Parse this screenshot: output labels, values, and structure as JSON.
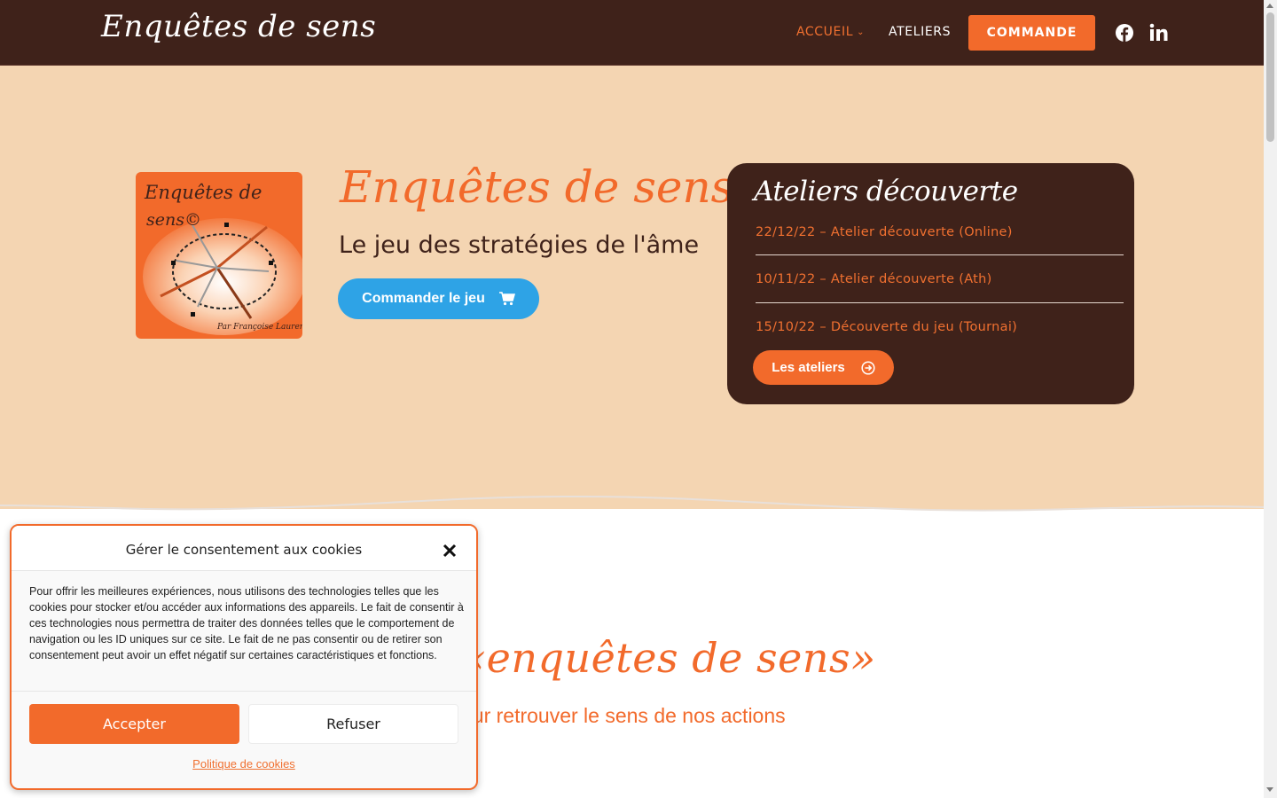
{
  "header": {
    "logo": "Enquêtes de sens",
    "nav": [
      {
        "label": "ACCUEIL",
        "active": true
      },
      {
        "label": "ATELIERS",
        "active": false
      }
    ],
    "cta": "COMMANDE",
    "social": [
      "facebook-icon",
      "linkedin-icon"
    ]
  },
  "hero": {
    "box_text_line1": "Enquêtes de",
    "box_text_line2": "sens©",
    "box_author": "Par Françoise Laurent",
    "title": "Enquêtes de sens",
    "subtitle": "Le jeu des stratégies de l'âme",
    "order_button": "Commander le jeu"
  },
  "card": {
    "title": "Ateliers découverte",
    "events": [
      "22/12/22 – Atelier découverte (Online)",
      "10/11/22 – Atelier découverte (Ath)",
      "15/10/22 – Découverte du jeu (Tournai)"
    ],
    "button": "Les ateliers"
  },
  "section": {
    "title": "«enquêtes de sens»",
    "subtitle": "our retrouver le sens de nos actions"
  },
  "cookie": {
    "title": "Gérer le consentement aux cookies",
    "body": "Pour offrir les meilleures expériences, nous utilisons des technologies telles que les cookies pour stocker et/ou accéder aux informations des appareils. Le fait de consentir à ces technologies nous permettra de traiter des données telles que le comportement de navigation ou les ID uniques sur ce site. Le fait de ne pas consentir ou de retirer son consentement peut avoir un effet négatif sur certaines caractéristiques et fonctions.",
    "accept": "Accepter",
    "refuse": "Refuser",
    "policy": "Politique de cookies"
  },
  "colors": {
    "brown": "#3f221a",
    "orange": "#f26a2b",
    "sand": "#f4d5b2",
    "blue": "#2ea3e6"
  }
}
